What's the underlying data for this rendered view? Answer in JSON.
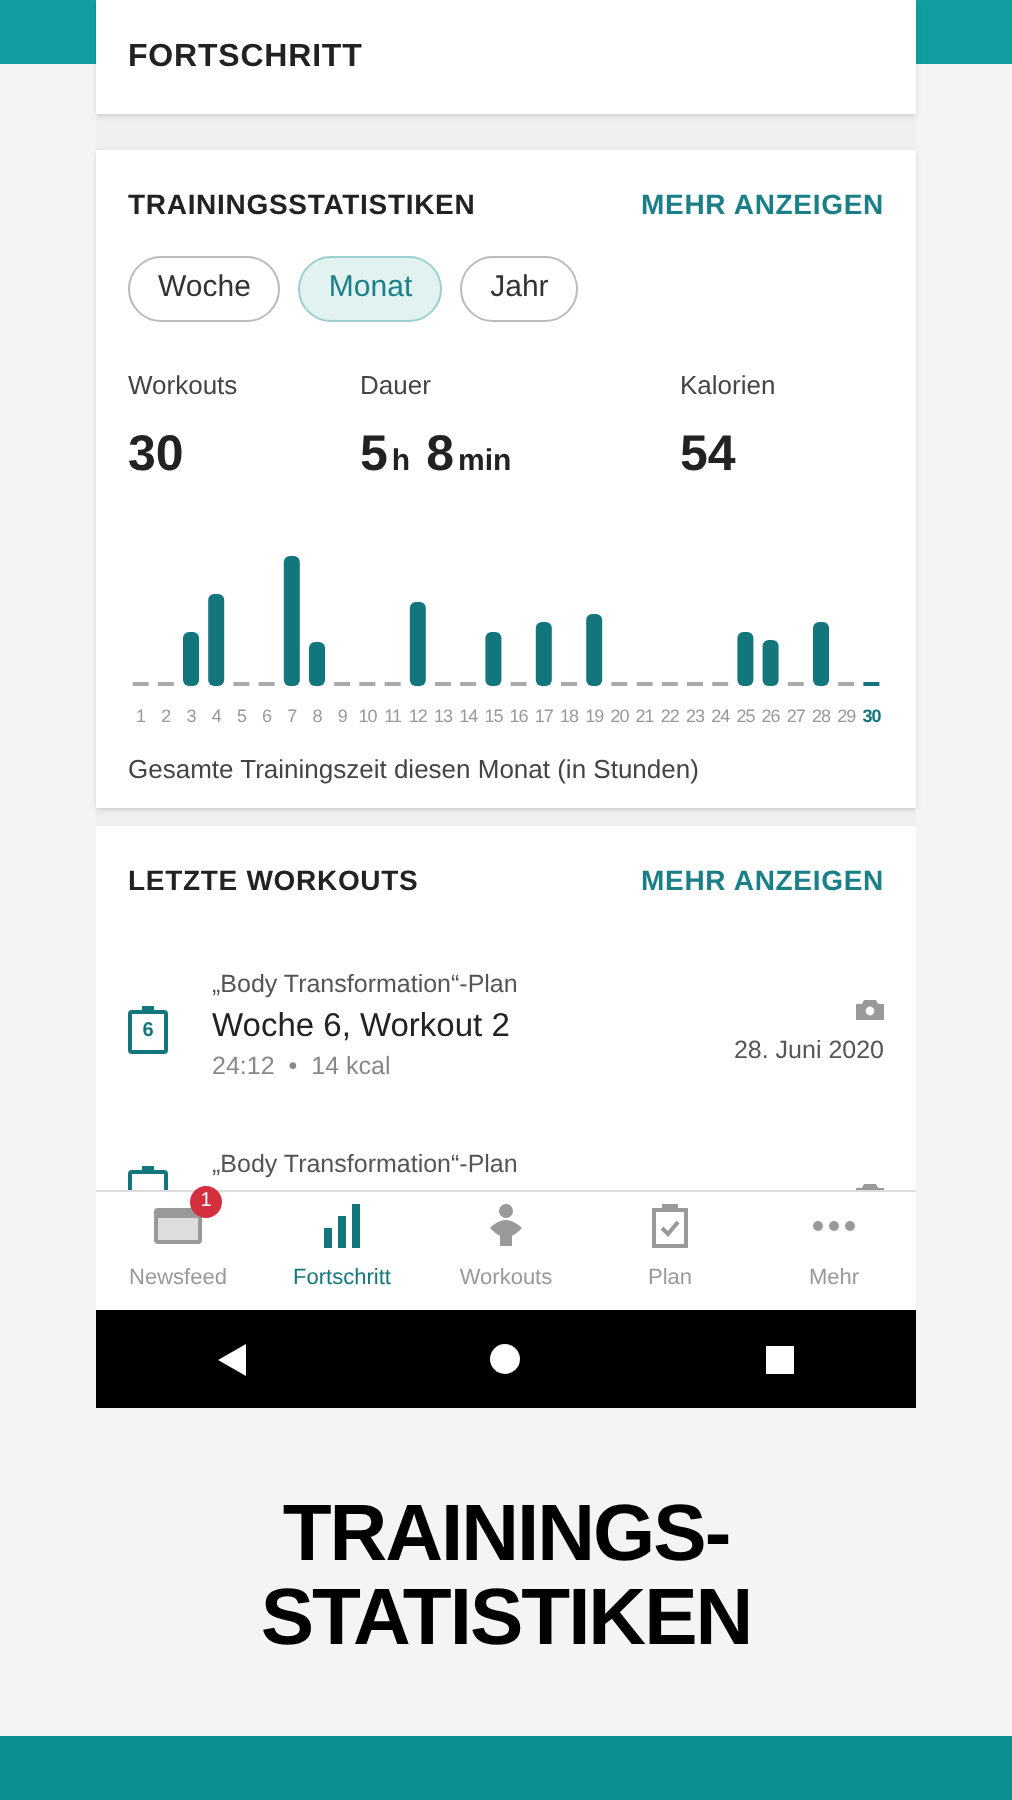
{
  "header": {
    "title": "FORTSCHRITT"
  },
  "stats_card": {
    "title": "TRAININGSSTATISTIKEN",
    "more_link": "MEHR ANZEIGEN",
    "periods": [
      {
        "label": "Woche",
        "selected": false
      },
      {
        "label": "Monat",
        "selected": true
      },
      {
        "label": "Jahr",
        "selected": false
      }
    ],
    "metrics": [
      {
        "label": "Workouts",
        "value": [
          {
            "kind": "number",
            "text": "30"
          }
        ]
      },
      {
        "label": "Dauer",
        "value": [
          {
            "kind": "number",
            "text": "5"
          },
          {
            "kind": "unit",
            "text": "h"
          },
          {
            "kind": "number",
            "text": "8"
          },
          {
            "kind": "unit",
            "text": "min"
          }
        ]
      },
      {
        "label": "Kalorien",
        "value": [
          {
            "kind": "number",
            "text": "54"
          }
        ]
      }
    ],
    "chart": {
      "days": [
        {
          "label": "1",
          "selected": false
        },
        {
          "label": "2",
          "selected": false
        },
        {
          "label": "3",
          "selected": false
        },
        {
          "label": "4",
          "selected": false
        },
        {
          "label": "5",
          "selected": false
        },
        {
          "label": "6",
          "selected": false
        },
        {
          "label": "7",
          "selected": false
        },
        {
          "label": "8",
          "selected": false
        },
        {
          "label": "9",
          "selected": false
        },
        {
          "label": "10",
          "selected": false
        },
        {
          "label": "11",
          "selected": false
        },
        {
          "label": "12",
          "selected": false
        },
        {
          "label": "13",
          "selected": false
        },
        {
          "label": "14",
          "selected": false
        },
        {
          "label": "15",
          "selected": false
        },
        {
          "label": "16",
          "selected": false
        },
        {
          "label": "17",
          "selected": false
        },
        {
          "label": "18",
          "selected": false
        },
        {
          "label": "19",
          "selected": false
        },
        {
          "label": "20",
          "selected": false
        },
        {
          "label": "21",
          "selected": false
        },
        {
          "label": "22",
          "selected": false
        },
        {
          "label": "23",
          "selected": false
        },
        {
          "label": "24",
          "selected": false
        },
        {
          "label": "25",
          "selected": false
        },
        {
          "label": "26",
          "selected": false
        },
        {
          "label": "27",
          "selected": false
        },
        {
          "label": "28",
          "selected": false
        },
        {
          "label": "29",
          "selected": false
        },
        {
          "label": "30",
          "selected": true
        }
      ],
      "caption": "Gesamte Trainingszeit diesen Monat (in Stunden)"
    }
  },
  "workouts_card": {
    "title": "LETZTE WORKOUTS",
    "more_link": "MEHR ANZEIGEN",
    "items": [
      {
        "plan": "„Body Transformation“-Plan",
        "title": "Woche 6, Workout 2",
        "day_badge": "6",
        "meta": [
          "24:12",
          "14 kcal"
        ],
        "separator": "•",
        "date": "28. Juni 2020"
      },
      {
        "plan": "„Body Transformation“-Plan"
      }
    ]
  },
  "bottom_nav": [
    {
      "kind": "newsfeed",
      "label": "Newsfeed",
      "selected": false,
      "badge": "1"
    },
    {
      "kind": "progress",
      "label": "Fortschritt",
      "selected": true
    },
    {
      "kind": "workouts",
      "label": "Workouts",
      "selected": false
    },
    {
      "kind": "plan",
      "label": "Plan",
      "selected": false
    },
    {
      "kind": "more",
      "label": "Mehr",
      "selected": false
    }
  ],
  "promo": {
    "lines": [
      "TRAININGS-",
      "STATISTIKEN"
    ]
  }
}
